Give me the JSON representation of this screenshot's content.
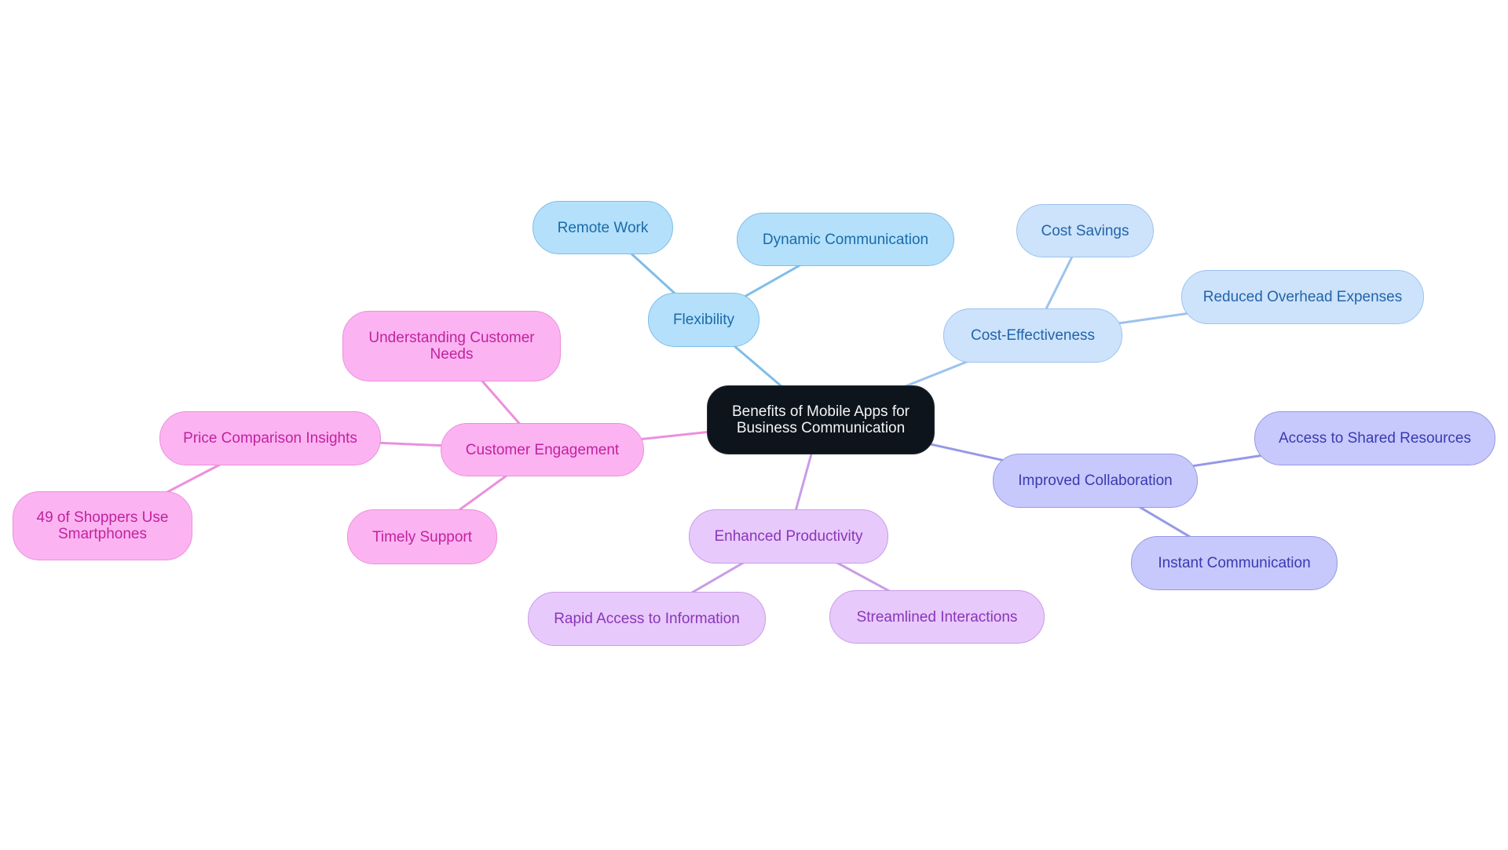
{
  "title": "Benefits of Mobile Apps for Business Communication",
  "palette": {
    "root": {
      "fill": "#0e141b",
      "stroke": "#2a2f36",
      "text": "#f2f4f7",
      "edge": "#0e141b"
    },
    "flex": {
      "fill": "#b4e0fb",
      "stroke": "#7fbde8",
      "text": "#1a6ba8",
      "edge": "#7fbde8"
    },
    "cost": {
      "fill": "#cce3fb",
      "stroke": "#9cc3ee",
      "text": "#2464a8",
      "edge": "#9cc3ee"
    },
    "collab": {
      "fill": "#c7c9fc",
      "stroke": "#9698e6",
      "text": "#3a3ab0",
      "edge": "#9698e6"
    },
    "prod": {
      "fill": "#e7c9fb",
      "stroke": "#c99ce8",
      "text": "#8a36b8",
      "edge": "#c99ce8"
    },
    "engage": {
      "fill": "#fbb4f1",
      "stroke": "#ec8fdc",
      "text": "#c2229f",
      "edge": "#ec8fdc"
    }
  },
  "nodes": [
    {
      "id": "root",
      "label": "Benefits of Mobile Apps for Business Communication",
      "group": "root",
      "parent": null
    },
    {
      "id": "flexibility",
      "label": "Flexibility",
      "group": "flex",
      "parent": "root"
    },
    {
      "id": "remote-work",
      "label": "Remote Work",
      "group": "flex",
      "parent": "flexibility"
    },
    {
      "id": "dynamic-communication",
      "label": "Dynamic Communication",
      "group": "flex",
      "parent": "flexibility"
    },
    {
      "id": "cost-effectiveness",
      "label": "Cost-Effectiveness",
      "group": "cost",
      "parent": "root"
    },
    {
      "id": "cost-savings",
      "label": "Cost Savings",
      "group": "cost",
      "parent": "cost-effectiveness"
    },
    {
      "id": "reduced-overhead",
      "label": "Reduced Overhead Expenses",
      "group": "cost",
      "parent": "cost-effectiveness"
    },
    {
      "id": "improved-collaboration",
      "label": "Improved Collaboration",
      "group": "collab",
      "parent": "root"
    },
    {
      "id": "access-shared-resources",
      "label": "Access to Shared Resources",
      "group": "collab",
      "parent": "improved-collaboration"
    },
    {
      "id": "instant-communication",
      "label": "Instant Communication",
      "group": "collab",
      "parent": "improved-collaboration"
    },
    {
      "id": "enhanced-productivity",
      "label": "Enhanced Productivity",
      "group": "prod",
      "parent": "root"
    },
    {
      "id": "rapid-access",
      "label": "Rapid Access to Information",
      "group": "prod",
      "parent": "enhanced-productivity"
    },
    {
      "id": "streamlined-interactions",
      "label": "Streamlined Interactions",
      "group": "prod",
      "parent": "enhanced-productivity"
    },
    {
      "id": "customer-engagement",
      "label": "Customer Engagement",
      "group": "engage",
      "parent": "root"
    },
    {
      "id": "understanding-needs",
      "label": "Understanding Customer Needs",
      "group": "engage",
      "parent": "customer-engagement"
    },
    {
      "id": "price-comparison",
      "label": "Price Comparison Insights",
      "group": "engage",
      "parent": "customer-engagement"
    },
    {
      "id": "shoppers-smartphones",
      "label": "49 of Shoppers Use Smartphones",
      "group": "engage",
      "parent": "price-comparison"
    },
    {
      "id": "timely-support",
      "label": "Timely Support",
      "group": "engage",
      "parent": "customer-engagement"
    }
  ]
}
